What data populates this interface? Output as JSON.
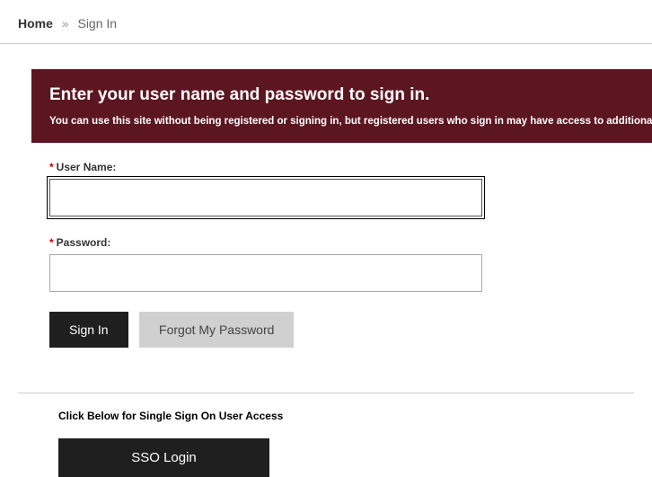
{
  "breadcrumb": {
    "home": "Home",
    "separator": "»",
    "current": "Sign In"
  },
  "banner": {
    "heading": "Enter your user name and password to sign in.",
    "subtext": "You can use this site without being registered or signing in, but registered users who sign in may have access to additional features and information."
  },
  "form": {
    "username_label": "User Name:",
    "username_value": "",
    "password_label": "Password:",
    "password_value": "",
    "required_mark": "*"
  },
  "buttons": {
    "sign_in": "Sign In",
    "forgot": "Forgot My Password"
  },
  "sso": {
    "prompt": "Click Below for Single Sign On User Access",
    "button": "SSO  Login"
  }
}
